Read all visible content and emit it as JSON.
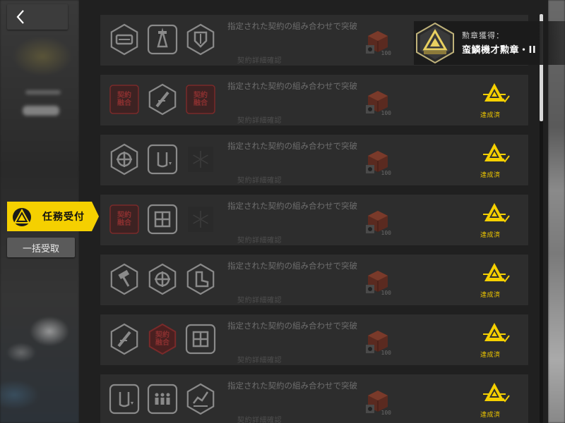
{
  "nav": {
    "back_icon": "chevron-left-icon",
    "accept_tab_label": "任務受付",
    "bulk_claim_label": "一括受取"
  },
  "colors": {
    "accent_yellow": "#f5d000",
    "panel_bg": "#202020",
    "card_bg": "#2d2d2d"
  },
  "achievement": {
    "title": "勲章獲得：",
    "name": "蛮鱗機才勲章・II",
    "badge_icon": "medal-triangle-badge-icon"
  },
  "missions": [
    {
      "contracts": [
        {
          "icon": "hex-vehicle-contract-icon",
          "style": "hex",
          "active": false
        },
        {
          "icon": "square-tower-contract-icon",
          "style": "square",
          "active": false
        },
        {
          "icon": "hex-shield-contract-icon",
          "style": "hex",
          "active": false
        }
      ],
      "desc": "指定された契約の組み合わせで突破",
      "detail": "契約詳細確認",
      "reward_count": "100",
      "reward_icon": "red-crate-icon",
      "status": ""
    },
    {
      "contracts": [
        {
          "icon": "red-kanji-contract-icon",
          "style": "square-red",
          "active": true,
          "text": "契約\n融合"
        },
        {
          "icon": "hex-slash-contract-icon",
          "style": "hex",
          "active": false
        },
        {
          "icon": "red-kanji-contract-icon",
          "style": "square-red",
          "active": true,
          "text": "契約\n融合"
        }
      ],
      "desc": "指定された契約の組み合わせで突破",
      "detail": "契約詳細確認",
      "reward_count": "100",
      "reward_icon": "red-crate-icon",
      "status": "達成済"
    },
    {
      "contracts": [
        {
          "icon": "hex-crosshair-contract-icon",
          "style": "hex",
          "active": false
        },
        {
          "icon": "square-gauge-contract-icon",
          "style": "square",
          "active": false
        },
        {
          "icon": "snowflake-contract-icon",
          "style": "faint",
          "active": false
        }
      ],
      "desc": "指定された契約の組み合わせで突破",
      "detail": "契約詳細確認",
      "reward_count": "100",
      "reward_icon": "red-crate-icon",
      "status": "達成済"
    },
    {
      "contracts": [
        {
          "icon": "red-kanji-contract-icon",
          "style": "square-red",
          "active": true,
          "text": "契約\n融合"
        },
        {
          "icon": "square-grid-contract-icon",
          "style": "square",
          "active": false
        },
        {
          "icon": "snowflake-contract-icon",
          "style": "faint",
          "active": false
        }
      ],
      "desc": "指定された契約の組み合わせで突破",
      "detail": "契約詳細確認",
      "reward_count": "100",
      "reward_icon": "red-crate-icon",
      "status": "達成済"
    },
    {
      "contracts": [
        {
          "icon": "hex-hammer-contract-icon",
          "style": "hex",
          "active": false
        },
        {
          "icon": "hex-crosshair-contract-icon",
          "style": "hex",
          "active": false
        },
        {
          "icon": "hex-boot-contract-icon",
          "style": "hex",
          "active": false
        }
      ],
      "desc": "指定された契約の組み合わせで突破",
      "detail": "契約詳細確認",
      "reward_count": "100",
      "reward_icon": "red-crate-icon",
      "status": "達成済"
    },
    {
      "contracts": [
        {
          "icon": "hex-slash-contract-icon",
          "style": "hex",
          "active": false
        },
        {
          "icon": "red-kanji-contract-icon",
          "style": "hex-red",
          "active": true,
          "text": "契約\n融合"
        },
        {
          "icon": "square-plus-contract-icon",
          "style": "square",
          "active": false
        }
      ],
      "desc": "指定された契約の組み合わせで突破",
      "detail": "契約詳細確認",
      "reward_count": "100",
      "reward_icon": "red-crate-icon",
      "status": "達成済"
    },
    {
      "contracts": [
        {
          "icon": "square-gauge-contract-icon",
          "style": "square",
          "active": false
        },
        {
          "icon": "square-people-contract-icon",
          "style": "square",
          "active": false
        },
        {
          "icon": "hex-chart-contract-icon",
          "style": "hex",
          "active": false
        }
      ],
      "desc": "指定された契約の組み合わせで突破",
      "detail": "契約詳細確認",
      "reward_count": "100",
      "reward_icon": "red-crate-icon",
      "status": "達成済"
    }
  ]
}
